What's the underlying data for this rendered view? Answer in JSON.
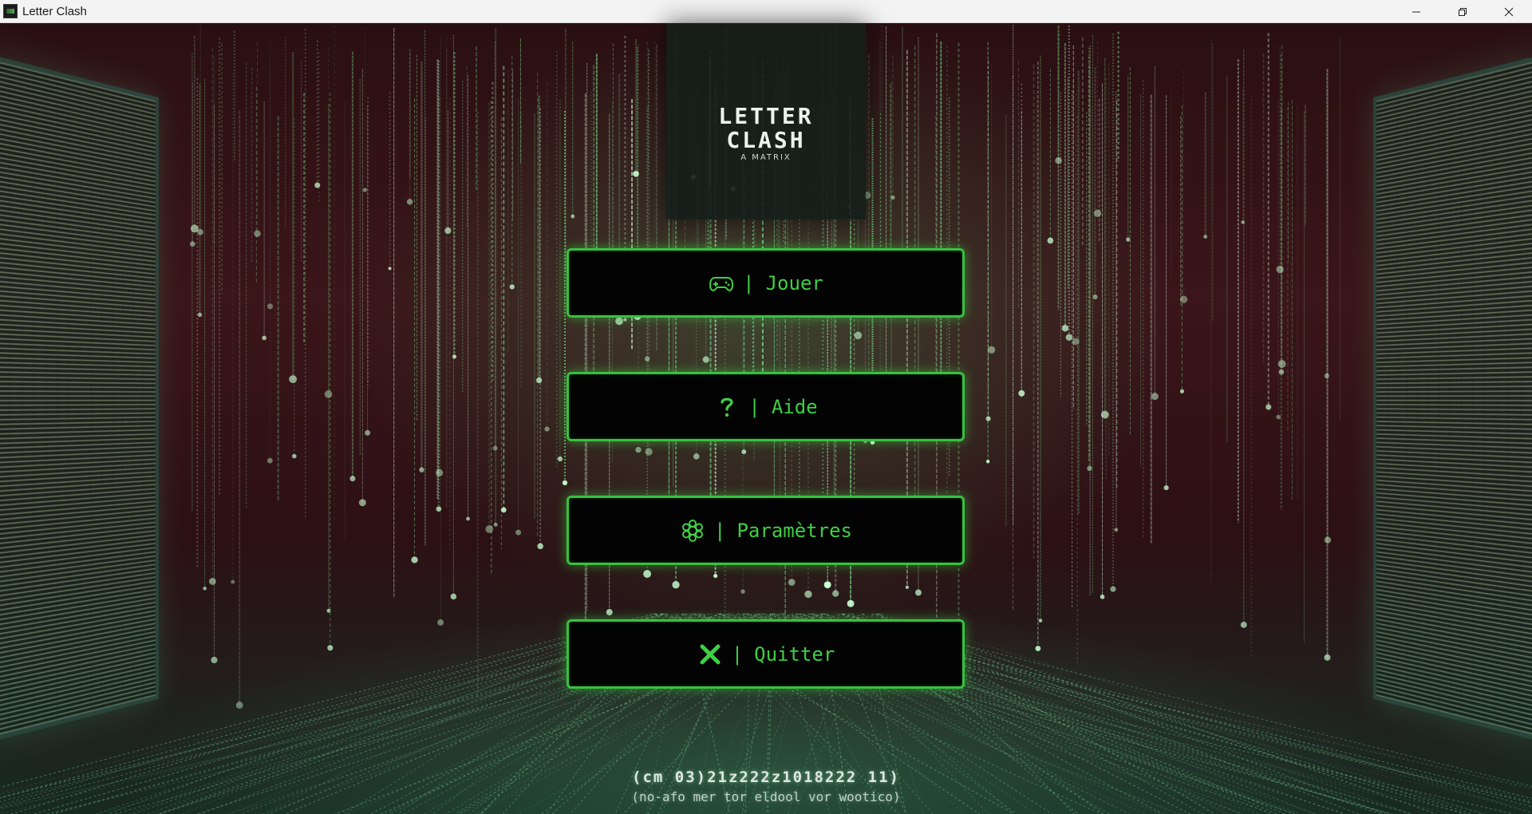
{
  "window": {
    "title": "Letter Clash"
  },
  "logo": {
    "line1": "LETTER",
    "line2": "CLASH",
    "subtitle": "A MATRIX"
  },
  "menu": {
    "buttons": [
      {
        "icon": "gamepad-icon",
        "separator": "|",
        "label": "Jouer"
      },
      {
        "icon": "question-icon",
        "separator": "|",
        "label": "Aide"
      },
      {
        "icon": "gear-icon",
        "separator": "|",
        "label": "Paramètres"
      },
      {
        "icon": "close-x-icon",
        "separator": "|",
        "label": "Quitter"
      }
    ]
  },
  "colors": {
    "accent_green": "#3fcf45",
    "button_border": "#39c13f",
    "button_bg": "#020302"
  },
  "footer": {
    "line1": "(cm 03)21z222z1018222 11)",
    "line2": "(no-afo mer tor eldool vor wootico)"
  }
}
